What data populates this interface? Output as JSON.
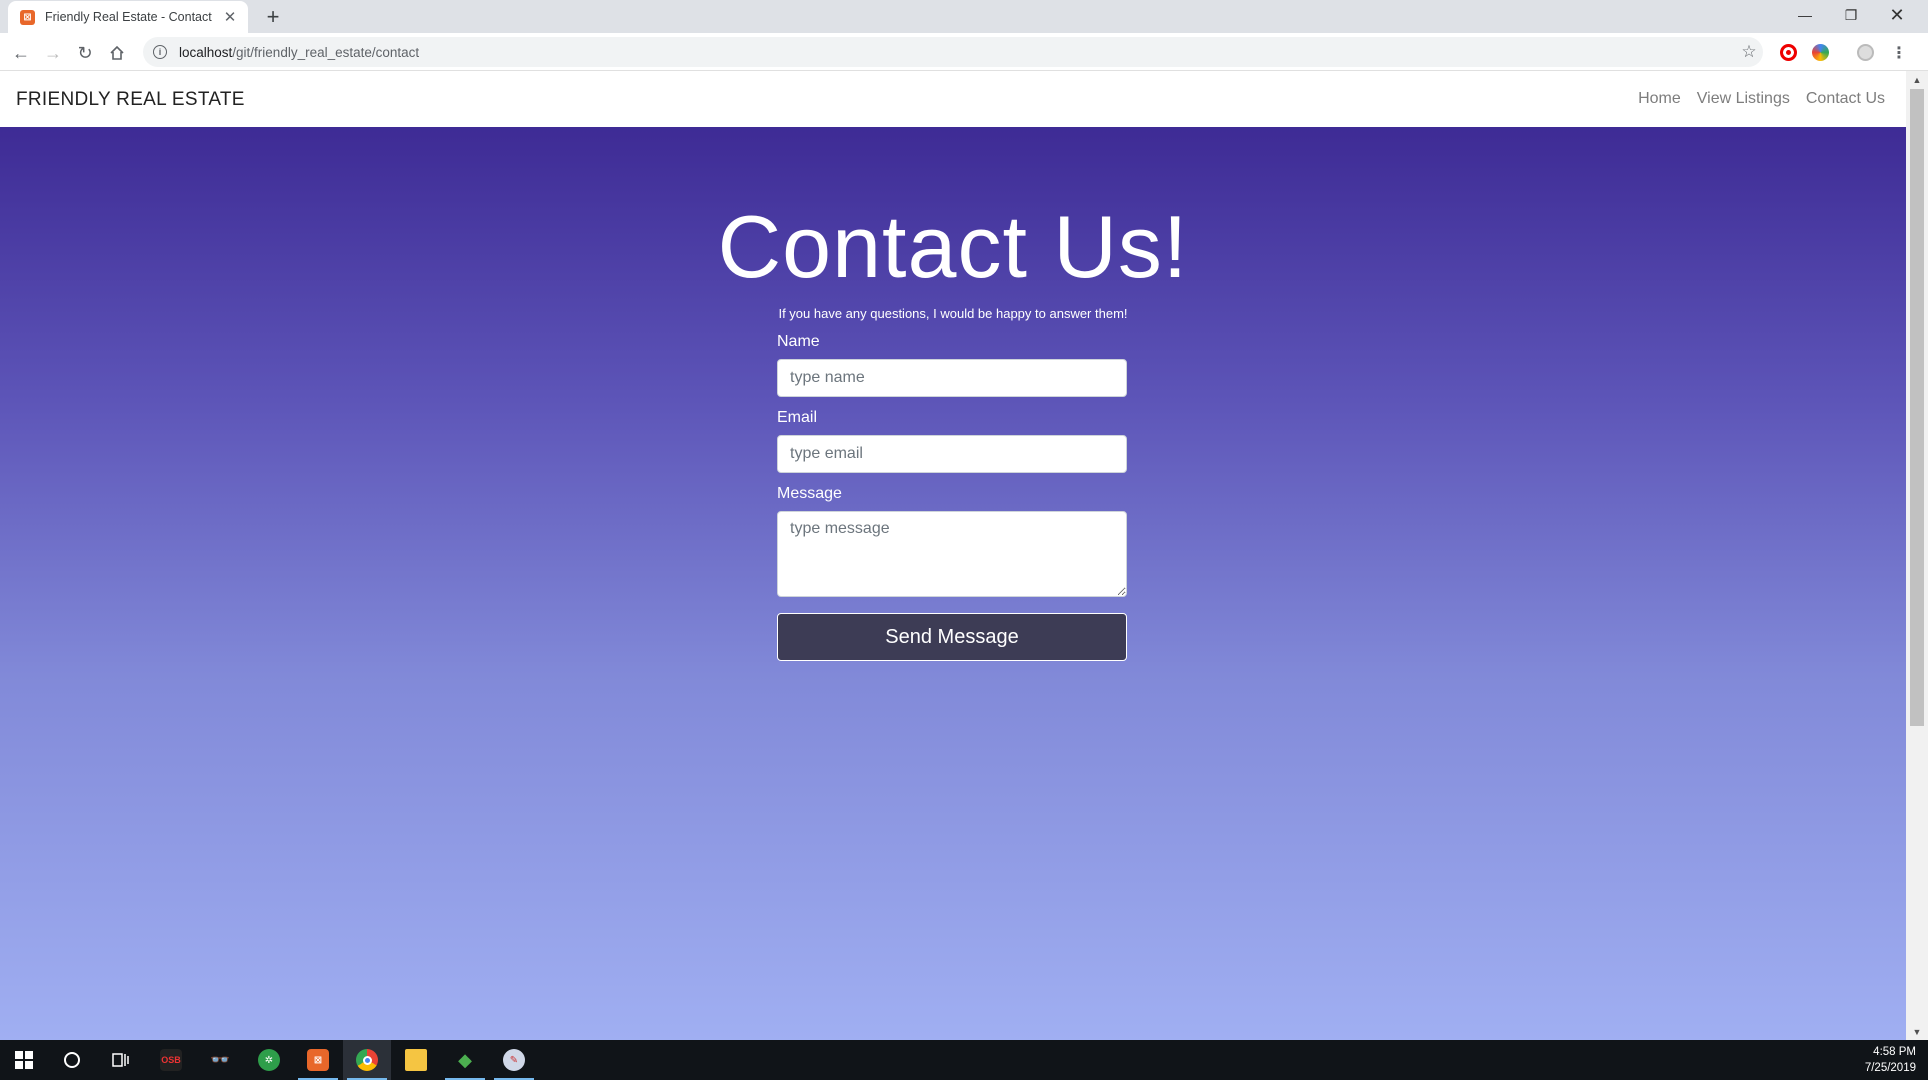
{
  "browser": {
    "tab_title": "Friendly Real Estate - Contact",
    "url_host": "localhost",
    "url_path": "/git/friendly_real_estate/contact"
  },
  "site": {
    "brand": "FRIENDLY REAL ESTATE",
    "nav": [
      {
        "label": "Home"
      },
      {
        "label": "View Listings"
      },
      {
        "label": "Contact Us"
      }
    ]
  },
  "contact": {
    "title": "Contact Us!",
    "subtitle": "If you have any questions, I would be happy to answer them!",
    "name_label": "Name",
    "name_placeholder": "type name",
    "email_label": "Email",
    "email_placeholder": "type email",
    "message_label": "Message",
    "message_placeholder": "type message",
    "submit_label": "Send Message"
  },
  "taskbar": {
    "obs_label": "OSB",
    "time": "4:58 PM",
    "date": "7/25/2019"
  },
  "colors": {
    "hero_top": "#3e2b95",
    "hero_bottom": "#a0aff2",
    "button": "#3d3c55"
  }
}
